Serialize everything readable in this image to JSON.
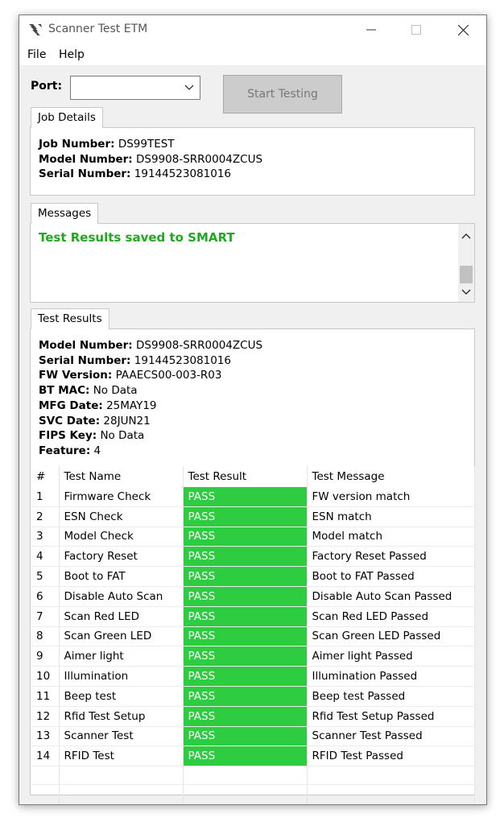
{
  "window": {
    "title": "Scanner Test ETM"
  },
  "menu": {
    "file": "File",
    "help": "Help"
  },
  "port": {
    "label": "Port:",
    "value": ""
  },
  "start_button": "Start Testing",
  "job_details": {
    "tab": "Job Details",
    "fields": [
      {
        "label": "Job Number:",
        "value": "DS99TEST"
      },
      {
        "label": "Model Number:",
        "value": "DS9908-SRR0004ZCUS"
      },
      {
        "label": "Serial Number:",
        "value": "19144523081016"
      }
    ]
  },
  "messages": {
    "tab": "Messages",
    "text": "Test Results saved to SMART",
    "color": "#21a821"
  },
  "test_results": {
    "tab": "Test Results",
    "fields": [
      {
        "label": "Model Number:",
        "value": "DS9908-SRR0004ZCUS"
      },
      {
        "label": "Serial Number:",
        "value": "19144523081016"
      },
      {
        "label": "FW Version:",
        "value": "PAAECS00-003-R03"
      },
      {
        "label": "BT MAC:",
        "value": "No Data"
      },
      {
        "label": "MFG Date:",
        "value": "25MAY19"
      },
      {
        "label": "SVC Date:",
        "value": "28JUN21"
      },
      {
        "label": "FIPS Key:",
        "value": "No Data"
      },
      {
        "label": "Feature:",
        "value": "4"
      }
    ],
    "columns": [
      "#",
      "Test Name",
      "Test Result",
      "Test Message"
    ],
    "pass_color": "#2ecc40",
    "rows": [
      {
        "num": "1",
        "name": "Firmware Check",
        "result": "PASS",
        "message": "FW version match"
      },
      {
        "num": "2",
        "name": "ESN Check",
        "result": "PASS",
        "message": "ESN match"
      },
      {
        "num": "3",
        "name": "Model Check",
        "result": "PASS",
        "message": "Model match"
      },
      {
        "num": "4",
        "name": "Factory Reset",
        "result": "PASS",
        "message": "Factory Reset Passed"
      },
      {
        "num": "5",
        "name": "Boot to FAT",
        "result": "PASS",
        "message": "Boot to FAT Passed"
      },
      {
        "num": "6",
        "name": "Disable Auto Scan",
        "result": "PASS",
        "message": "Disable Auto Scan Passed"
      },
      {
        "num": "7",
        "name": "Scan Red LED",
        "result": "PASS",
        "message": "Scan Red LED Passed"
      },
      {
        "num": "8",
        "name": "Scan Green LED",
        "result": "PASS",
        "message": "Scan Green LED Passed"
      },
      {
        "num": "9",
        "name": "Aimer light",
        "result": "PASS",
        "message": "Aimer light Passed"
      },
      {
        "num": "10",
        "name": "Illumination",
        "result": "PASS",
        "message": "Illumination Passed"
      },
      {
        "num": "11",
        "name": "Beep test",
        "result": "PASS",
        "message": "Beep test Passed"
      },
      {
        "num": "12",
        "name": "Rfid Test Setup",
        "result": "PASS",
        "message": "Rfid Test Setup Passed"
      },
      {
        "num": "13",
        "name": "Scanner Test",
        "result": "PASS",
        "message": "Scanner Test Passed"
      },
      {
        "num": "14",
        "name": "RFID Test",
        "result": "PASS",
        "message": "RFID Test Passed"
      }
    ]
  }
}
